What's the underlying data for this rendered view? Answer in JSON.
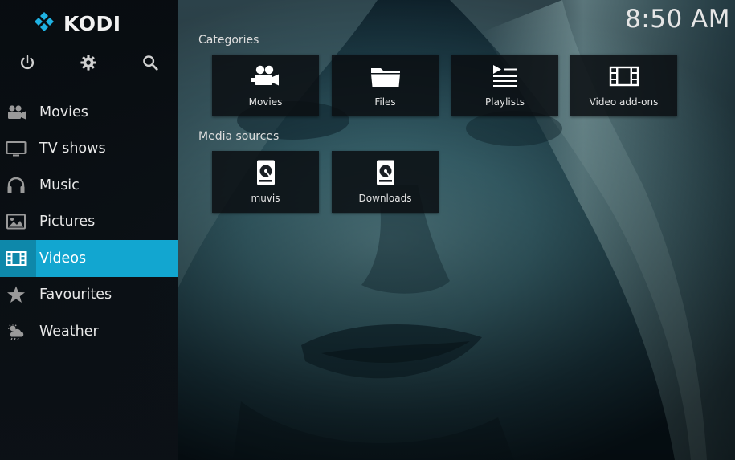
{
  "app": {
    "name": "KODI",
    "clock": "8:50 AM"
  },
  "top_controls": [
    {
      "id": "power",
      "icon": "power-icon"
    },
    {
      "id": "settings",
      "icon": "gear-icon"
    },
    {
      "id": "search",
      "icon": "search-icon"
    }
  ],
  "sidebar": {
    "items": [
      {
        "label": "Movies",
        "icon": "movie-camera-icon",
        "active": false
      },
      {
        "label": "TV shows",
        "icon": "tv-icon",
        "active": false
      },
      {
        "label": "Music",
        "icon": "headphones-icon",
        "active": false
      },
      {
        "label": "Pictures",
        "icon": "picture-icon",
        "active": false
      },
      {
        "label": "Videos",
        "icon": "film-strip-icon",
        "active": true
      },
      {
        "label": "Favourites",
        "icon": "star-icon",
        "active": false
      },
      {
        "label": "Weather",
        "icon": "weather-icon",
        "active": false
      }
    ]
  },
  "main": {
    "categories_title": "Categories",
    "categories": [
      {
        "label": "Movies",
        "icon": "movie-camera-icon"
      },
      {
        "label": "Files",
        "icon": "folder-icon"
      },
      {
        "label": "Playlists",
        "icon": "playlist-icon"
      },
      {
        "label": "Video add-ons",
        "icon": "film-strip-icon"
      }
    ],
    "sources_title": "Media sources",
    "sources": [
      {
        "label": "muvis",
        "icon": "hard-drive-icon"
      },
      {
        "label": "Downloads",
        "icon": "hard-drive-icon"
      }
    ]
  },
  "colors": {
    "accent": "#12a6d0",
    "sidebar_bg": "#0c1116",
    "tile_bg": "#0e1216",
    "text": "#e8e8e8"
  }
}
